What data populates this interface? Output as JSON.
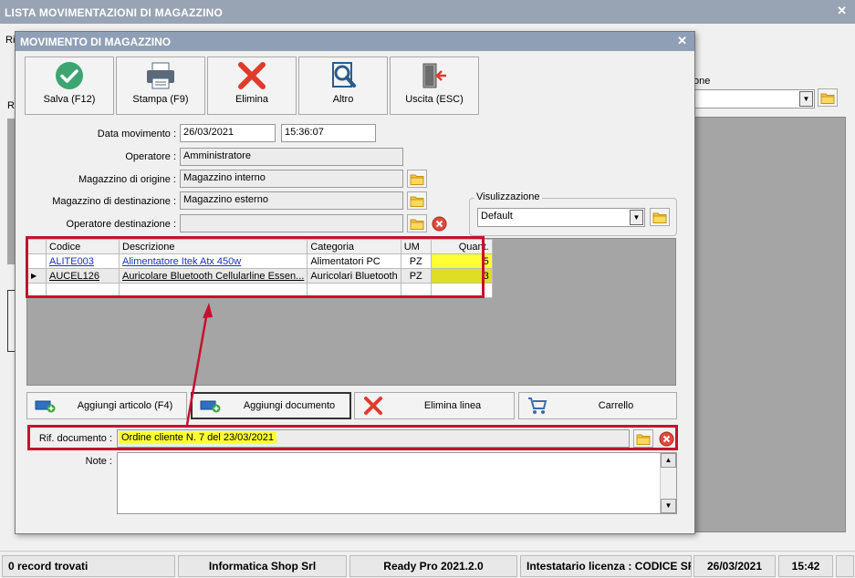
{
  "outer": {
    "title": "LISTA MOVIMENTAZIONI DI MAGAZZINO",
    "close": "✕",
    "frag_ri1": "Ri",
    "frag_ri2": "Ri",
    "frag_ione": "one"
  },
  "dialog": {
    "title": "MOVIMENTO DI MAGAZZINO",
    "close": "✕"
  },
  "toolbar": {
    "save_label": "Salva (F12)",
    "print_label": "Stampa (F9)",
    "delete_label": "Elimina",
    "other_label": "Altro",
    "exit_label": "Uscita (ESC)"
  },
  "form": {
    "data_movimento_label": "Data movimento :",
    "data_movimento_value": "26/03/2021",
    "ora_value": "15:36:07",
    "operatore_label": "Operatore :",
    "operatore_value": "Amministratore",
    "mag_origine_label": "Magazzino di origine :",
    "mag_origine_value": "Magazzino interno",
    "mag_dest_label": "Magazzino di destinazione :",
    "mag_dest_value": "Magazzino esterno",
    "op_dest_label": "Operatore destinazione :",
    "op_dest_value": "",
    "visual_label": "Visulizzazione",
    "visual_value": "Default"
  },
  "grid": {
    "columns": [
      "Codice",
      "Descrizione",
      "Categoria",
      "UM",
      "Quant."
    ],
    "rows": [
      {
        "codice": "ALITE003",
        "descrizione": "Alimentatore Itek Atx 450w",
        "categoria": "Alimentatori PC",
        "um": "PZ",
        "quant": "5"
      },
      {
        "codice": "AUCEL126",
        "descrizione": "Auricolare Bluetooth Cellularline Essen...",
        "categoria": "Auricolari Bluetooth",
        "um": "PZ",
        "quant": "3"
      }
    ]
  },
  "actions": {
    "add_item": "Aggiungi articolo (F4)",
    "add_doc": "Aggiungi documento",
    "delete_line": "Elimina linea",
    "cart": "Carrello"
  },
  "rif": {
    "label": "Rif. documento :",
    "value": "Ordine cliente N. 7 del 23/03/2021"
  },
  "note": {
    "label": "Note :",
    "value": ""
  },
  "status": {
    "records": "0 record trovati",
    "company": "Informatica Shop Srl",
    "version": "Ready Pro 2021.2.0",
    "license": "Intestatario licenza : CODICE SRL",
    "date": "26/03/2021",
    "time": "15:42"
  },
  "colors": {
    "title_bar": "#8fa0b6",
    "highlight": "#ffff33",
    "annotation": "#c8102e",
    "link": "#1a2fc0"
  }
}
